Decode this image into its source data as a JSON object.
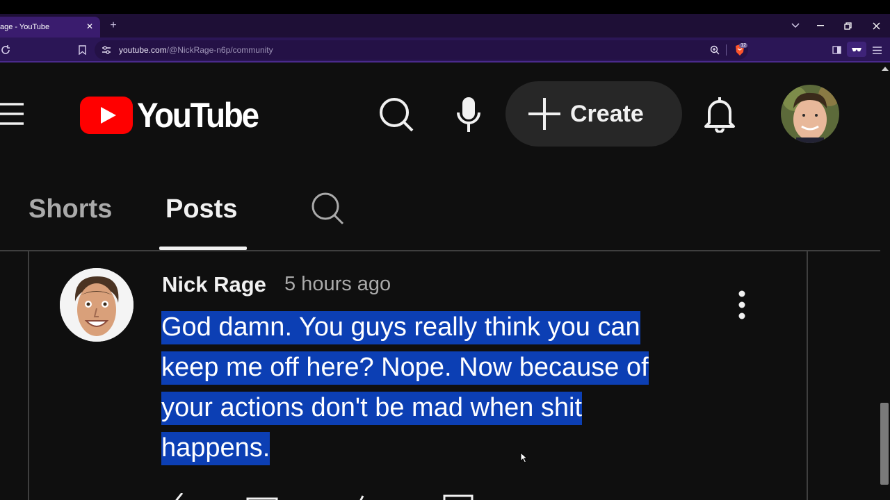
{
  "browser": {
    "tab_title": "age - YouTube",
    "url_host": "youtube.com",
    "url_path": "/@NickRage-n6p/community",
    "shield_badge": "12"
  },
  "header": {
    "logo_text": "YouTube",
    "create_label": "Create"
  },
  "channel_tabs": [
    {
      "label": "Shorts",
      "active": false
    },
    {
      "label": "Posts",
      "active": true
    }
  ],
  "post": {
    "author": "Nick Rage",
    "time": "5 hours ago",
    "text_lines": [
      "God damn. You guys really think you can",
      "keep me off here? Nope. Now because of",
      "your actions don't be mad when shit",
      "happens."
    ]
  },
  "colors": {
    "accent_red": "#ff0000",
    "selection": "#0c3fb4",
    "browser_purple": "#2b1656"
  },
  "icons": [
    "reload-icon",
    "bookmark-icon",
    "site-info-icon",
    "zoom-icon",
    "brave-shield-icon",
    "sidebar-icon",
    "vpn-icon",
    "menu-icon",
    "hamburger-icon",
    "search-icon",
    "mic-icon",
    "plus-icon",
    "bell-icon",
    "more-vert-icon"
  ]
}
